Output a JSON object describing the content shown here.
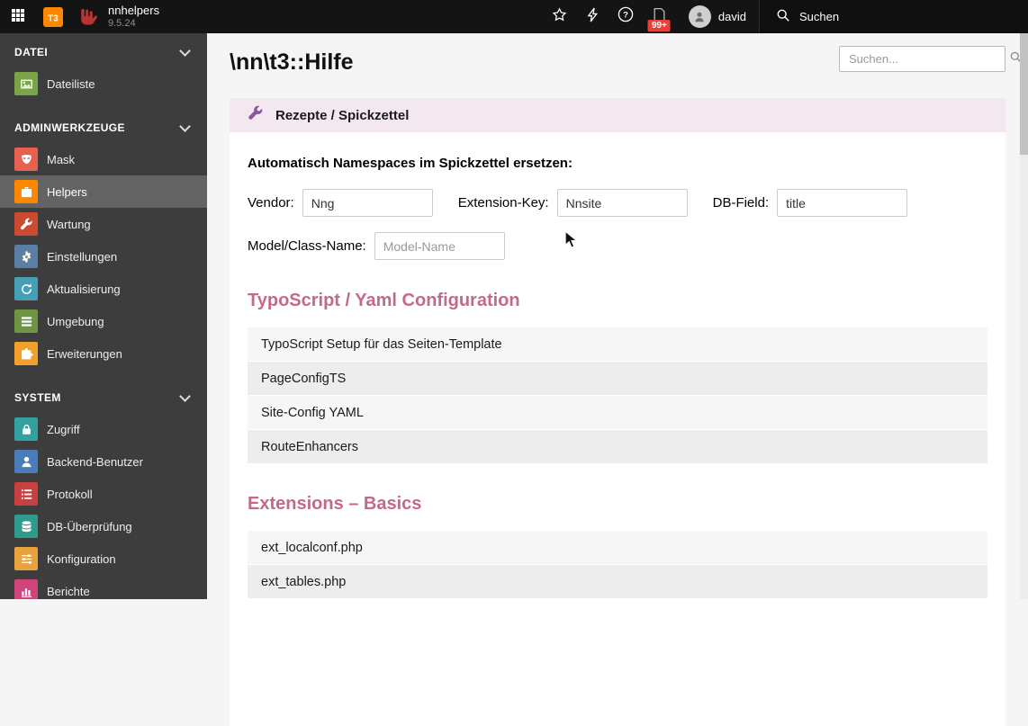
{
  "topbar": {
    "brand_name": "nnhelpers",
    "brand_version": "9.5.24",
    "user_name": "david",
    "search_label": "Suchen",
    "docs_badge": "99+",
    "icons": [
      "modules-grid-icon",
      "typo3-logo",
      "nnhelpers-logo",
      "star-icon",
      "bolt-icon",
      "help-icon",
      "document-badge-icon",
      "avatar",
      "search-icon"
    ]
  },
  "sidebar": {
    "sections": [
      {
        "label": "DATEI",
        "chevron": "chevron-down-icon",
        "items": [
          {
            "label": "Dateiliste",
            "icon": "file-list-icon",
            "color": "#79a548"
          }
        ]
      },
      {
        "label": "ADMINWERKZEUGE",
        "chevron": "chevron-down-icon",
        "items": [
          {
            "label": "Mask",
            "icon": "mask-icon",
            "color": "#e8604f"
          },
          {
            "label": "Helpers",
            "icon": "toolbox-icon",
            "color": "#ff8700",
            "active": true
          },
          {
            "label": "Wartung",
            "icon": "wrench-icon",
            "color": "#cc4a31"
          },
          {
            "label": "Einstellungen",
            "icon": "gear-icon",
            "color": "#5b7fa3"
          },
          {
            "label": "Aktualisierung",
            "icon": "refresh-icon",
            "color": "#45a0b5"
          },
          {
            "label": "Umgebung",
            "icon": "environment-icon",
            "color": "#6f9442"
          },
          {
            "label": "Erweiterungen",
            "icon": "puzzle-icon",
            "color": "#f1a02b"
          }
        ]
      },
      {
        "label": "SYSTEM",
        "chevron": "chevron-down-icon",
        "items": [
          {
            "label": "Zugriff",
            "icon": "lock-icon",
            "color": "#35a0a0"
          },
          {
            "label": "Backend-Benutzer",
            "icon": "user-icon",
            "color": "#4a7db8"
          },
          {
            "label": "Protokoll",
            "icon": "log-icon",
            "color": "#c94040"
          },
          {
            "label": "DB-Überprüfung",
            "icon": "database-icon",
            "color": "#2e9b8e"
          },
          {
            "label": "Konfiguration",
            "icon": "sliders-icon",
            "color": "#e8a33d"
          },
          {
            "label": "Berichte",
            "icon": "report-chart-icon",
            "color": "#d0447c"
          }
        ]
      }
    ]
  },
  "main": {
    "page_title": "\\nn\\t3::Hilfe",
    "search_placeholder": "Suchen...",
    "panel_header": "Rezepte / Spickzettel",
    "panel_icon": "wrench-icon",
    "form": {
      "title": "Automatisch Namespaces im Spickzettel ersetzen:",
      "vendor_label": "Vendor:",
      "vendor_value": "Nng",
      "extkey_label": "Extension-Key:",
      "extkey_value": "Nnsite",
      "dbfield_label": "DB-Field:",
      "dbfield_value": "title",
      "model_label": "Model/Class-Name:",
      "model_placeholder": "Model-Name"
    },
    "sections": [
      {
        "heading": "TypoScript / Yaml Configuration",
        "items": [
          "TypoScript Setup für das Seiten-Template",
          "PageConfigTS",
          "Site-Config YAML",
          "RouteEnhancers"
        ]
      },
      {
        "heading": "Extensions – Basics",
        "items": [
          "ext_localconf.php",
          "ext_tables.php"
        ]
      }
    ]
  },
  "colors": {
    "accent_heading": "#c4688f",
    "panel_header_bg": "#f3e7f0",
    "topbar_bg": "#141414",
    "sidebar_bg": "#3d3d3d",
    "active_item_bg": "#636363",
    "badge_red": "#e8413c"
  }
}
